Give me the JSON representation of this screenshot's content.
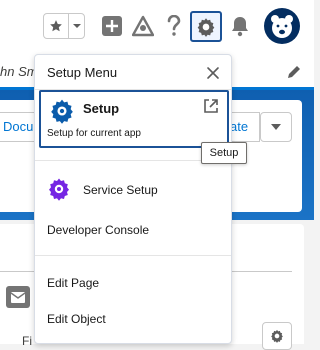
{
  "page": {
    "nav_partial_text": "hn Sm",
    "docu_button_partial": "Docu",
    "ate_button_partial": "ate",
    "fi_partial": "Fi"
  },
  "icons": {
    "favorites": "star-icon",
    "favorites_menu": "chevron-down-icon",
    "add": "plus-icon",
    "trailhead": "trailhead-icon",
    "help": "question-icon",
    "setup": "gear-icon",
    "notifications": "bell-icon",
    "avatar": "bear-avatar"
  },
  "setup_menu": {
    "title": "Setup Menu",
    "items": [
      {
        "label": "Setup",
        "description": "Setup for current app",
        "icon": "gear-icon",
        "external": true
      },
      {
        "label": "Service Setup",
        "icon": "gear-icon"
      },
      {
        "label": "Developer Console"
      },
      {
        "label": "Edit Page"
      },
      {
        "label": "Edit Object"
      }
    ]
  },
  "tooltip": {
    "text": "Setup"
  },
  "colors": {
    "accent": "#1b5297",
    "setup_gear": "#0b5cab",
    "service_gear": "#7526e3",
    "header_band": "#1b73c6"
  }
}
